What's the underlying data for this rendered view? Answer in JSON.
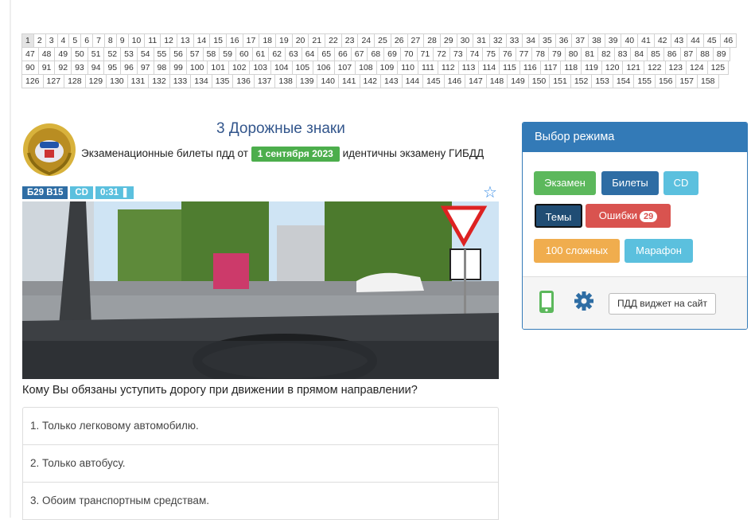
{
  "pager": {
    "pages": [
      "1",
      "2",
      "3",
      "4",
      "5",
      "6",
      "7",
      "8",
      "9",
      "10",
      "11",
      "12",
      "13",
      "14",
      "15",
      "16",
      "17",
      "18",
      "19",
      "20",
      "21",
      "22",
      "23",
      "24",
      "25",
      "26",
      "27",
      "28",
      "29",
      "30",
      "31",
      "32",
      "33",
      "34",
      "35",
      "36",
      "37",
      "38",
      "39",
      "40",
      "41",
      "42",
      "43",
      "44",
      "45",
      "46",
      "47",
      "48",
      "49",
      "50",
      "51",
      "52",
      "53",
      "54",
      "55",
      "56",
      "57",
      "58",
      "59",
      "60",
      "61",
      "62",
      "63",
      "64",
      "65",
      "66",
      "67",
      "68",
      "69",
      "70",
      "71",
      "72",
      "73",
      "74",
      "75",
      "76",
      "77",
      "78",
      "79",
      "80",
      "81",
      "82",
      "83",
      "84",
      "85",
      "86",
      "87",
      "88",
      "89",
      "90",
      "91",
      "92",
      "93",
      "94",
      "95",
      "96",
      "97",
      "98",
      "99",
      "100",
      "101",
      "102",
      "103",
      "104",
      "105",
      "106",
      "107",
      "108",
      "109",
      "110",
      "111",
      "112",
      "113",
      "114",
      "115",
      "116",
      "117",
      "118",
      "119",
      "120",
      "121",
      "122",
      "123",
      "124",
      "125",
      "126",
      "127",
      "128",
      "129",
      "130",
      "131",
      "132",
      "133",
      "134",
      "135",
      "136",
      "137",
      "138",
      "139",
      "140",
      "141",
      "142",
      "143",
      "144",
      "145",
      "146",
      "147",
      "148",
      "149",
      "150",
      "151",
      "152",
      "153",
      "154",
      "155",
      "156",
      "157",
      "158"
    ],
    "active": "1"
  },
  "header": {
    "title": "3 Дорожные знаки",
    "intro_before": "Экзаменационные билеты пдд от",
    "date_badge": "1 сентября 2023",
    "intro_after": "идентичны экзамену ГИБДД"
  },
  "tags": {
    "ticket": "Б29 В15",
    "category": "CD",
    "timer": "0:31"
  },
  "icons": {
    "star": "star-icon",
    "mobile": "mobile-phone-icon",
    "settings": "gear-icon",
    "pause": "pause-icon"
  },
  "question": {
    "text": "Кому Вы обязаны уступить дорогу при движении в прямом направлении?",
    "answers": [
      "1. Только легковому автомобилю.",
      "2. Только автобусу.",
      "3. Обоим транспортным средствам."
    ]
  },
  "mode": {
    "title": "Выбор режима",
    "exam": "Экзамен",
    "tickets": "Билеты",
    "cd": "CD",
    "topics": "Темы",
    "mistakes": "Ошибки",
    "mistakes_count": "29",
    "hard": "100 сложных",
    "marathon": "Марафон",
    "widget": "ПДД виджет на сайт"
  },
  "colors": {
    "primary": "#337ab7",
    "success": "#5cb85c",
    "info": "#5bc0de",
    "danger": "#d9534f",
    "warning": "#f0ad4e"
  }
}
